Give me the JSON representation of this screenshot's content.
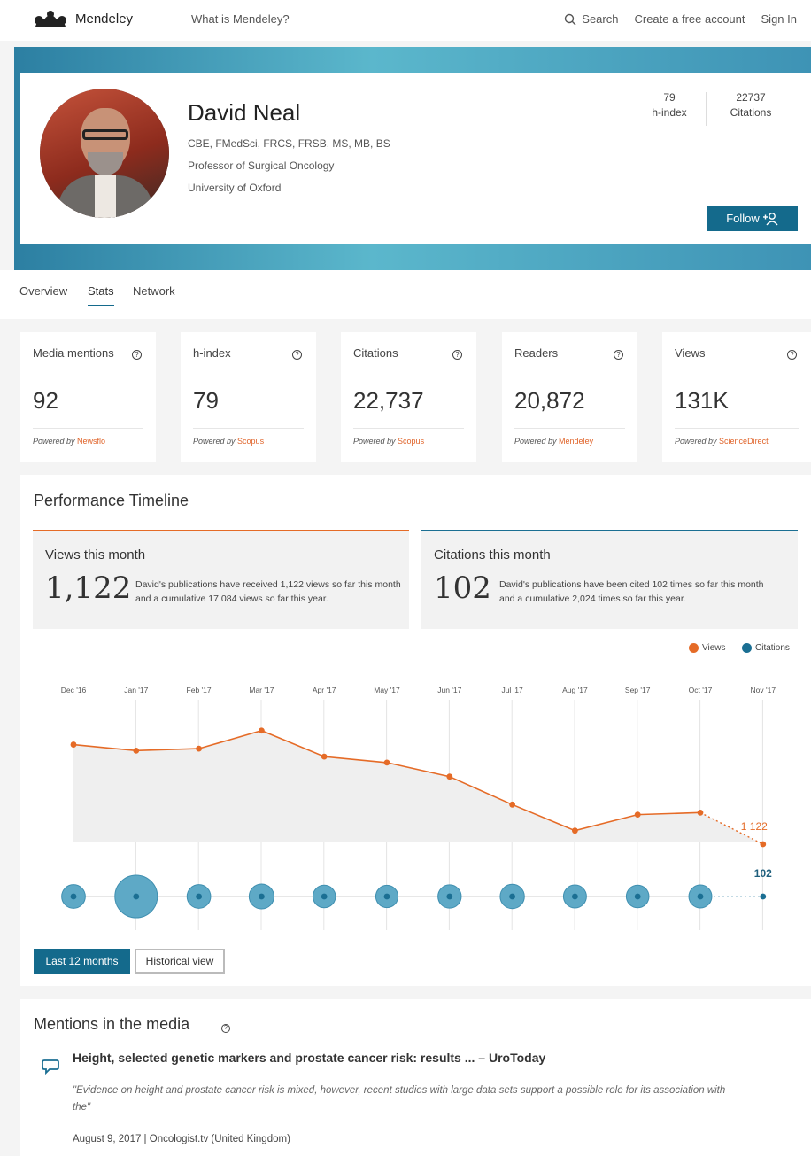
{
  "nav": {
    "logo_text": "Mendeley",
    "what_is": "What is Mendeley?",
    "search": "Search",
    "create_account": "Create a free account",
    "sign_in": "Sign In"
  },
  "profile": {
    "name": "David Neal",
    "credentials": "CBE, FMedSci, FRCS, FRSB, MS, MB, BS",
    "title": "Professor of Surgical Oncology",
    "institution": "University of Oxford",
    "h_index_value": "79",
    "h_index_label": "h-index",
    "citations_value": "22737",
    "citations_label": "Citations",
    "follow_label": "Follow"
  },
  "tabs": [
    "Overview",
    "Stats",
    "Network"
  ],
  "active_tab": "Stats",
  "metrics": [
    {
      "label": "Media mentions",
      "value": "92",
      "powered": "Powered by",
      "source": "Newsflo"
    },
    {
      "label": "h-index",
      "value": "79",
      "powered": "Powered by",
      "source": "Scopus"
    },
    {
      "label": "Citations",
      "value": "22,737",
      "powered": "Powered by",
      "source": "Scopus"
    },
    {
      "label": "Readers",
      "value": "20,872",
      "powered": "Powered by",
      "source": "Mendeley"
    },
    {
      "label": "Views",
      "value": "131K",
      "powered": "Powered by",
      "source": "ScienceDirect"
    }
  ],
  "performance": {
    "title": "Performance Timeline",
    "views_box": {
      "title": "Views this month",
      "value": "1,122",
      "desc": "David's publications have received 1,122 views so far this month and a cumulative 17,084 views so far this year."
    },
    "citations_box": {
      "title": "Citations this month",
      "value": "102",
      "desc": "David's publications have been cited 102 times so far this month and a cumulative 2,024 times so far this year."
    },
    "legend_views": "Views",
    "legend_citations": "Citations",
    "range_active": "Last 12 months",
    "range_alt": "Historical view"
  },
  "colors": {
    "views": "#e56b27",
    "citations": "#1b6f93",
    "citation_bubble": "#5ea9c6",
    "accent": "#146a8c"
  },
  "chart_data": {
    "type": "line",
    "categories": [
      "Dec '16",
      "Jan '17",
      "Feb '17",
      "Mar '17",
      "Apr '17",
      "May '17",
      "Jun '17",
      "Jul '17",
      "Aug '17",
      "Sep '17",
      "Oct '17",
      "Nov '17"
    ],
    "series": [
      {
        "name": "Views",
        "values": [
          1620,
          1590,
          1600,
          1690,
          1560,
          1530,
          1460,
          1320,
          1190,
          1270,
          1280,
          1122
        ],
        "last_label": "1 122"
      },
      {
        "name": "Citations",
        "values": [
          190,
          470,
          190,
          230,
          160,
          150,
          180,
          210,
          170,
          160,
          170,
          102
        ],
        "last_label": "102"
      }
    ],
    "views_ylim": [
      0,
      1800
    ],
    "legend_position": "top-right",
    "grid": "vertical"
  },
  "mentions": {
    "title": "Mentions in the media",
    "headline": "Height, selected genetic markers and prostate cancer risk: results ... – UroToday",
    "quote": "\"Evidence on height and prostate cancer risk is mixed, however, recent studies with large data sets support a possible role for its association with the\"",
    "meta": "August 9, 2017 | Oncologist.tv (United Kingdom)"
  }
}
